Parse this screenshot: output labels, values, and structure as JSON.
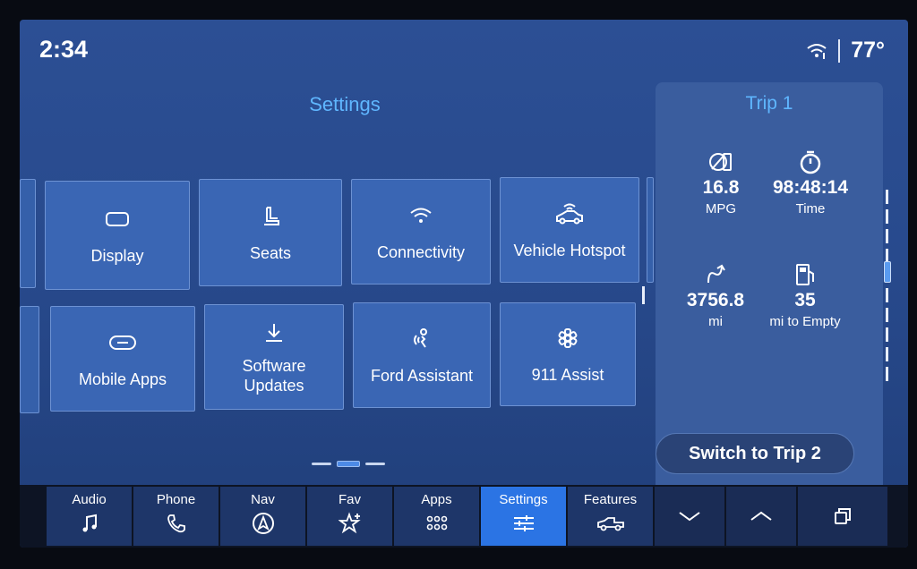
{
  "status": {
    "time": "2:34",
    "temperature": "77°"
  },
  "page": {
    "title": "Settings"
  },
  "tiles": [
    {
      "label": "Display",
      "icon": "display-icon"
    },
    {
      "label": "Seats",
      "icon": "seat-icon"
    },
    {
      "label": "Connectivity",
      "icon": "wifi-icon"
    },
    {
      "label": "Vehicle Hotspot",
      "icon": "hotspot-icon"
    },
    {
      "label": "Mobile Apps",
      "icon": "link-icon"
    },
    {
      "label": "Software\nUpdates",
      "icon": "download-icon"
    },
    {
      "label": "Ford Assistant",
      "icon": "voice-icon"
    },
    {
      "label": "911 Assist",
      "icon": "emergency-icon"
    }
  ],
  "trip": {
    "title": "Trip 1",
    "stats": [
      {
        "value": "16.8",
        "unit": "MPG",
        "icon": "fuel-economy-icon"
      },
      {
        "value": "98:48:14",
        "unit": "Time",
        "icon": "stopwatch-icon"
      },
      {
        "value": "3756.8",
        "unit": "mi",
        "icon": "distance-icon"
      },
      {
        "value": "35",
        "unit": "mi to Empty",
        "icon": "fuel-pump-icon"
      }
    ],
    "switch_label": "Switch to Trip 2"
  },
  "pager": {
    "pages": 3,
    "current": 2
  },
  "nav": [
    {
      "label": "Audio",
      "icon": "music-note-icon"
    },
    {
      "label": "Phone",
      "icon": "phone-icon"
    },
    {
      "label": "Nav",
      "icon": "navigation-icon"
    },
    {
      "label": "Fav",
      "icon": "star-icon"
    },
    {
      "label": "Apps",
      "icon": "apps-grid-icon"
    },
    {
      "label": "Settings",
      "icon": "sliders-icon",
      "active": true
    },
    {
      "label": "Features",
      "icon": "truck-icon"
    }
  ],
  "nav_controls": [
    {
      "icon": "chevron-down-icon"
    },
    {
      "icon": "chevron-up-icon"
    },
    {
      "icon": "windows-icon"
    }
  ],
  "colors": {
    "accent": "#5fb6ff",
    "active_nav": "#2b74e4",
    "tile": "#3a66b4"
  }
}
